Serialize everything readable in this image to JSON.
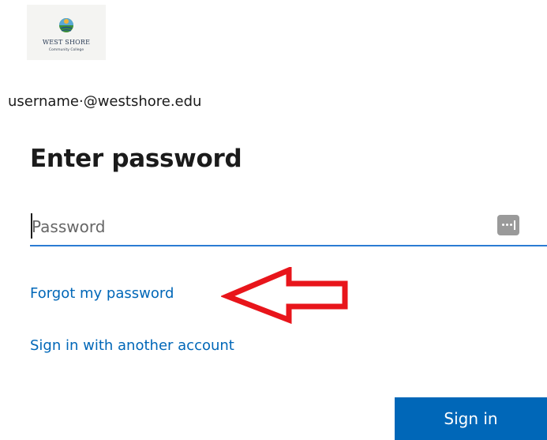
{
  "brand": {
    "name_line1": "WEST SHORE",
    "name_line2": "Community College"
  },
  "identity": {
    "username": "username·@westshore.edu"
  },
  "title": "Enter password",
  "password_field": {
    "placeholder": "Password",
    "value": ""
  },
  "links": {
    "forgot": "Forgot my password",
    "another_account": "Sign in with another account"
  },
  "sign_in_label": "Sign in",
  "colors": {
    "accent": "#0067b8",
    "annotation_arrow": "#e8151b"
  },
  "icons": {
    "reveal": "reveal-password-icon",
    "annotation": "arrow-left-icon"
  }
}
